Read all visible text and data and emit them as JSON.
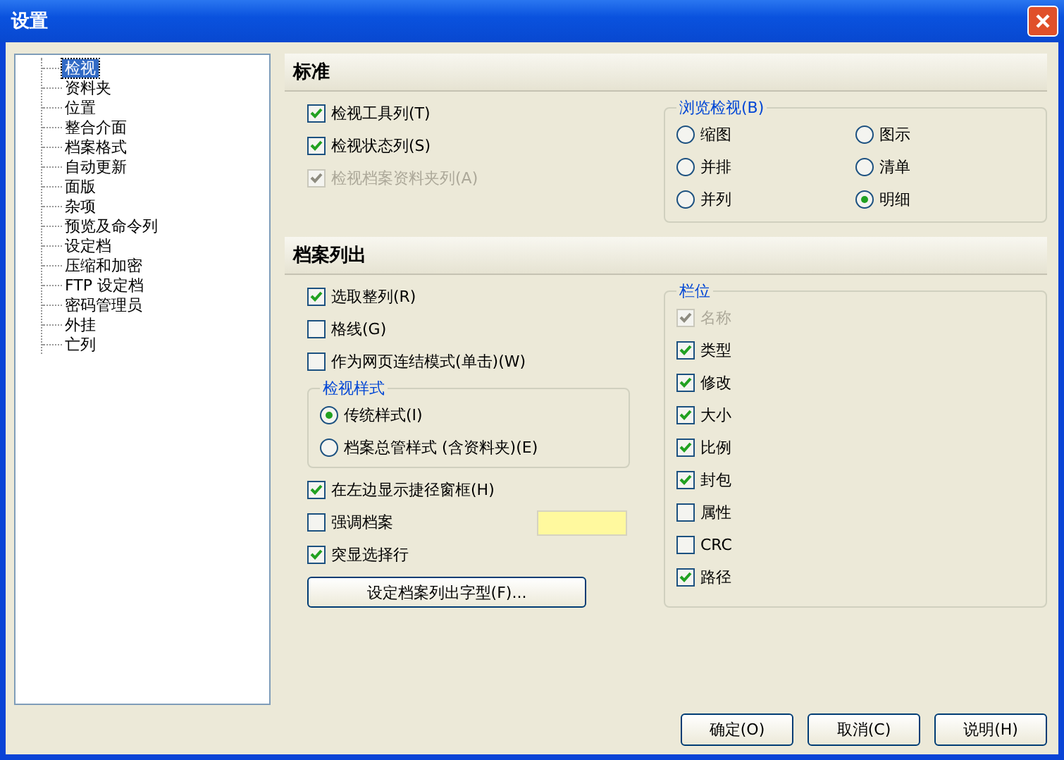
{
  "window": {
    "title": "设置"
  },
  "sidebar": {
    "items": [
      {
        "label": "检视",
        "selected": true
      },
      {
        "label": "资料夹",
        "selected": false
      },
      {
        "label": "位置",
        "selected": false
      },
      {
        "label": "整合介面",
        "selected": false
      },
      {
        "label": "档案格式",
        "selected": false
      },
      {
        "label": "自动更新",
        "selected": false
      },
      {
        "label": "面版",
        "selected": false
      },
      {
        "label": "杂项",
        "selected": false
      },
      {
        "label": "预览及命令列",
        "selected": false
      },
      {
        "label": "设定档",
        "selected": false
      },
      {
        "label": "压缩和加密",
        "selected": false
      },
      {
        "label": "FTP 设定档",
        "selected": false
      },
      {
        "label": "密码管理员",
        "selected": false
      },
      {
        "label": "外挂",
        "selected": false
      },
      {
        "label": "亡列",
        "selected": false
      }
    ]
  },
  "standard": {
    "title": "标准",
    "checkboxes": [
      {
        "label": "检视工具列(T)",
        "checked": true,
        "disabled": false
      },
      {
        "label": "检视状态列(S)",
        "checked": true,
        "disabled": false
      },
      {
        "label": "检视档案资料夹列(A)",
        "checked": true,
        "disabled": true
      }
    ],
    "browse_view": {
      "title": "浏览检视(B)",
      "options": [
        {
          "label": "缩图",
          "selected": false
        },
        {
          "label": "图示",
          "selected": false
        },
        {
          "label": "并排",
          "selected": false
        },
        {
          "label": "清单",
          "selected": false
        },
        {
          "label": "并列",
          "selected": false
        },
        {
          "label": "明细",
          "selected": true
        }
      ]
    }
  },
  "file_list": {
    "title": "档案列出",
    "checkboxes": [
      {
        "label": "选取整列(R)",
        "checked": true,
        "disabled": false
      },
      {
        "label": "格线(G)",
        "checked": false,
        "disabled": false
      },
      {
        "label": "作为网页连结模式(单击)(W)",
        "checked": false,
        "disabled": false
      }
    ],
    "view_style": {
      "title": "检视样式",
      "options": [
        {
          "label": "传统样式(I)",
          "selected": true
        },
        {
          "label": "档案总管样式 (含资料夹)(E)",
          "selected": false
        }
      ]
    },
    "more_checkboxes": [
      {
        "label": "在左边显示捷径窗框(H)",
        "checked": true,
        "disabled": false
      },
      {
        "label": "强调档案",
        "checked": false,
        "disabled": false,
        "color": "#fff99e"
      },
      {
        "label": "突显选择行",
        "checked": true,
        "disabled": false
      }
    ],
    "font_button": "设定档案列出字型(F)...",
    "columns": {
      "title": "栏位",
      "items": [
        {
          "label": "名称",
          "checked": true,
          "disabled": true
        },
        {
          "label": "类型",
          "checked": true,
          "disabled": false
        },
        {
          "label": "修改",
          "checked": true,
          "disabled": false
        },
        {
          "label": "大小",
          "checked": true,
          "disabled": false
        },
        {
          "label": "比例",
          "checked": true,
          "disabled": false
        },
        {
          "label": "封包",
          "checked": true,
          "disabled": false
        },
        {
          "label": "属性",
          "checked": false,
          "disabled": false
        },
        {
          "label": "CRC",
          "checked": false,
          "disabled": false
        },
        {
          "label": "路径",
          "checked": true,
          "disabled": false
        }
      ]
    }
  },
  "buttons": [
    "确定(O)",
    "取消(C)",
    "说明(H)"
  ]
}
